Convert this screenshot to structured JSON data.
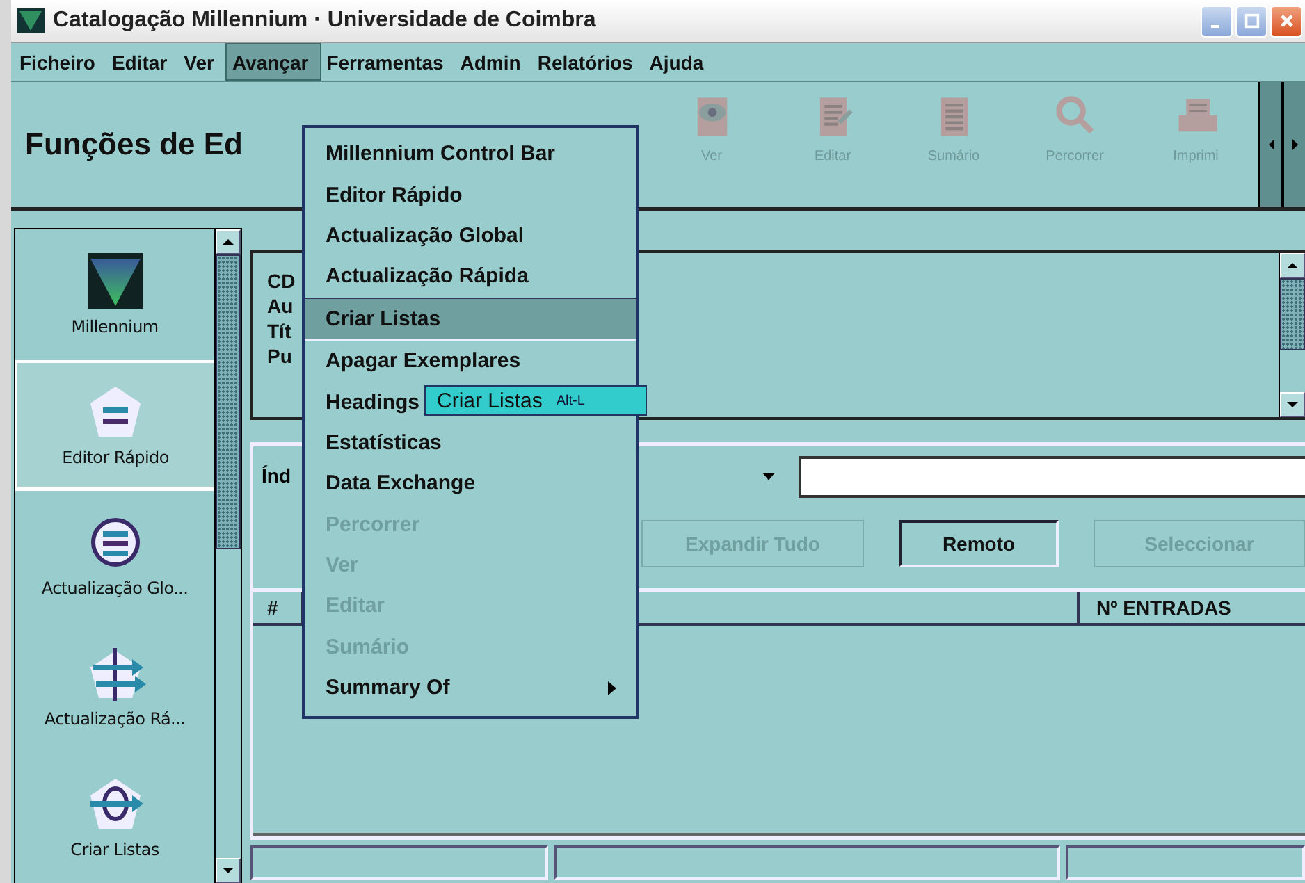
{
  "window": {
    "title": "Catalogação Millennium · Universidade de Coimbra"
  },
  "menu_bar": [
    {
      "label": "Ficheiro",
      "selected": false
    },
    {
      "label": "Editar",
      "selected": false
    },
    {
      "label": "Ver",
      "selected": false
    },
    {
      "label": "Avançar",
      "selected": true
    },
    {
      "label": "Ferramentas",
      "selected": false
    },
    {
      "label": "Admin",
      "selected": false
    },
    {
      "label": "Relatórios",
      "selected": false
    },
    {
      "label": "Ajuda",
      "selected": false
    }
  ],
  "heading": "Funções de Ed",
  "toolbar": [
    {
      "label": "Ver",
      "kind": "eye",
      "disabled": true
    },
    {
      "label": "Editar",
      "kind": "edit",
      "disabled": true
    },
    {
      "label": "Sumário",
      "kind": "summary",
      "disabled": true
    },
    {
      "label": "Percorrer",
      "kind": "search",
      "disabled": true
    },
    {
      "label": "Imprimi",
      "kind": "print",
      "disabled": true
    }
  ],
  "sidebar": {
    "items": [
      {
        "label": "Millennium",
        "kind": "logo",
        "selected": false
      },
      {
        "label": "Editor Rápido",
        "kind": "editor",
        "selected": true
      },
      {
        "label": "Actualização Glo...",
        "kind": "global",
        "selected": false
      },
      {
        "label": "Actualização Rá...",
        "kind": "rapid",
        "selected": false
      },
      {
        "label": "Criar Listas",
        "kind": "lists",
        "selected": false
      }
    ]
  },
  "record": {
    "labels": [
      "CD",
      "Au",
      "Tít",
      "Pu"
    ]
  },
  "index": {
    "label": "Índ"
  },
  "buttons": [
    {
      "label": "Expandir Tudo",
      "disabled": true
    },
    {
      "label": "Remoto",
      "disabled": false
    },
    {
      "label": "Seleccionar",
      "disabled": true
    }
  ],
  "table": {
    "columns": [
      "#",
      "Nº ENTRADAS"
    ]
  },
  "menu": {
    "items": [
      {
        "label": "Millennium Control Bar",
        "disabled": false,
        "selected": false,
        "submenu": false
      },
      {
        "label": "Editor Rápido",
        "disabled": false,
        "selected": false,
        "submenu": false
      },
      {
        "label": "Actualização Global",
        "disabled": false,
        "selected": false,
        "submenu": false
      },
      {
        "label": "Actualização Rápida",
        "disabled": false,
        "selected": false,
        "submenu": false
      },
      {
        "label": "Criar Listas",
        "disabled": false,
        "selected": true,
        "submenu": false
      },
      {
        "label": "Apagar Exemplares",
        "disabled": false,
        "selected": false,
        "submenu": false
      },
      {
        "label": "Headings",
        "disabled": false,
        "selected": false,
        "submenu": false
      },
      {
        "label": "Estatísticas",
        "disabled": false,
        "selected": false,
        "submenu": false
      },
      {
        "label": "Data Exchange",
        "disabled": false,
        "selected": false,
        "submenu": false
      },
      {
        "label": "Percorrer",
        "disabled": true,
        "selected": false,
        "submenu": false
      },
      {
        "label": "Ver",
        "disabled": true,
        "selected": false,
        "submenu": false
      },
      {
        "label": "Editar",
        "disabled": true,
        "selected": false,
        "submenu": false
      },
      {
        "label": "Sumário",
        "disabled": true,
        "selected": false,
        "submenu": false
      },
      {
        "label": "Summary Of",
        "disabled": false,
        "selected": false,
        "submenu": true
      }
    ]
  },
  "tooltip": {
    "label": "Criar Listas",
    "shortcut": "Alt-L"
  }
}
